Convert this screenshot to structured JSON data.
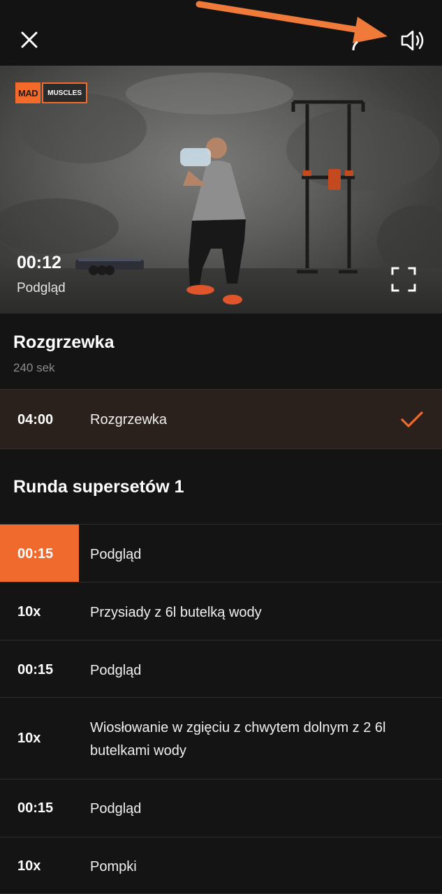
{
  "header": {
    "close_icon": "close-icon",
    "speaker_icon": "speaker-icon",
    "accent": "#F06A2E"
  },
  "video": {
    "logo_left": "MAD",
    "logo_right": "MUSCLES",
    "time": "00:12",
    "label": "Podgląd",
    "fullscreen_icon": "fullscreen-icon"
  },
  "warmup": {
    "title": "Rozgrzewka",
    "duration": "240 sek",
    "row": {
      "time": "04:00",
      "name": "Rozgrzewka",
      "completed": true
    }
  },
  "superset": {
    "title": "Runda supersetów 1",
    "rows": [
      {
        "time": "00:15",
        "name": "Podgląd",
        "active": true
      },
      {
        "time": "10x",
        "name": "Przysiady z 6l butelką wody"
      },
      {
        "time": "00:15",
        "name": "Podgląd"
      },
      {
        "time": "10x",
        "name": "Wiosłowanie w zgięciu z chwytem dolnym z 2 6l butelkami wody"
      },
      {
        "time": "00:15",
        "name": "Podgląd"
      },
      {
        "time": "10x",
        "name": "Pompki"
      }
    ]
  }
}
